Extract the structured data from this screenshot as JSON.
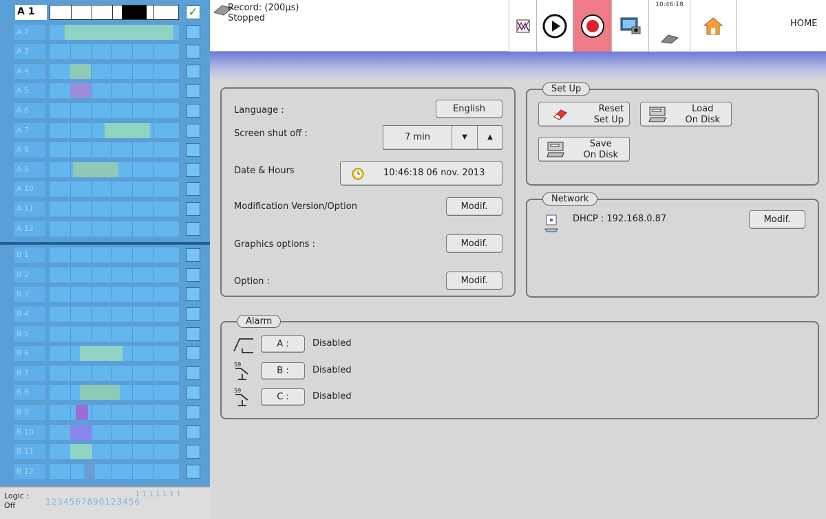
{
  "channels": {
    "first_label": "A 1",
    "check_glyph": "✓",
    "labels": [
      "A 2",
      "A 3",
      "A 4",
      "A 5",
      "A 6",
      "A 7",
      "A 8",
      "A 9",
      "A 10",
      "A 11",
      "A 12",
      "B 1",
      "B 2",
      "B 3",
      "B 4",
      "B 5",
      "B 6",
      "B 7",
      "B 8",
      "B 9",
      "B 10",
      "B 11",
      "B 12"
    ]
  },
  "logic": {
    "label": "Logic :",
    "state": "Off",
    "numbers": "123456789",
    "tens": "1111111",
    "units": "0123456"
  },
  "topbar": {
    "record_title": "Record: (200µs)",
    "record_state": "Stopped",
    "clock": "10:46:18",
    "home_label": "HOME",
    "accent_record": "#f07b86"
  },
  "general": {
    "language_label": "Language :",
    "language_value": "English",
    "screen_label": "Screen shut off :",
    "screen_value": "7 min",
    "date_label": "Date & Hours",
    "date_value": "10:46:18 06 nov. 2013",
    "modif_version_label": "Modification Version/Option",
    "graphics_label": "Graphics options :",
    "option_label": "Option :",
    "modif_label": "Modif."
  },
  "setup": {
    "title": "Set Up",
    "reset_line1": "Reset",
    "reset_line2": "Set Up",
    "load_line1": "Load",
    "load_line2": "On Disk",
    "save_line1": "Save",
    "save_line2": "On Disk"
  },
  "network": {
    "title": "Network",
    "dhcp": "DHCP : 192.168.0.87",
    "modif_label": "Modif."
  },
  "alarm": {
    "title": "Alarm",
    "items": [
      {
        "key": "A :",
        "status": "Disabled"
      },
      {
        "key": "B :",
        "status": "Disabled"
      },
      {
        "key": "C :",
        "status": "Disabled"
      }
    ]
  }
}
